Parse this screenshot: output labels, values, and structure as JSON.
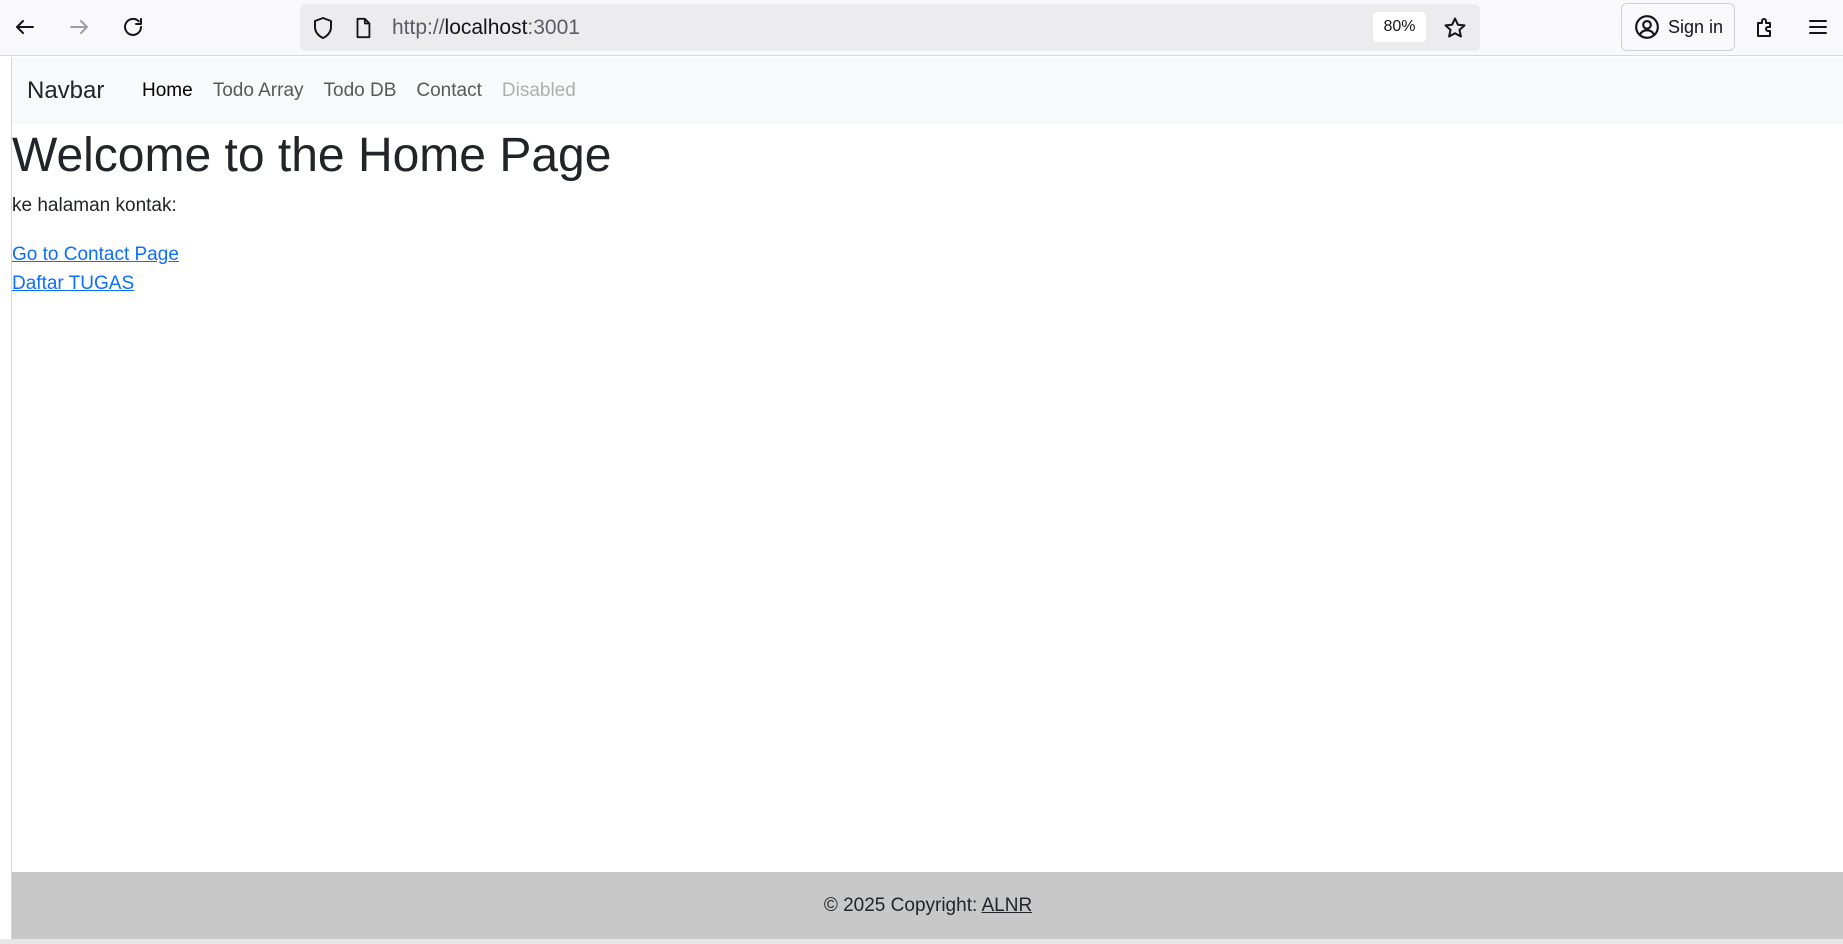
{
  "browser": {
    "url_scheme": "http://",
    "url_host": "localhost",
    "url_port": ":3001",
    "zoom": "80%",
    "sign_in_label": "Sign in",
    "icons": {
      "back": "arrow-left-icon",
      "forward": "arrow-right-icon",
      "reload": "reload-icon",
      "shield": "shield-icon",
      "page": "page-icon",
      "bookmark": "star-icon",
      "account": "account-icon",
      "extensions": "puzzle-icon",
      "menu": "hamburger-menu-icon"
    }
  },
  "navbar": {
    "brand": "Navbar",
    "links": [
      {
        "label": "Home",
        "state": "active"
      },
      {
        "label": "Todo Array",
        "state": "normal"
      },
      {
        "label": "Todo DB",
        "state": "normal"
      },
      {
        "label": "Contact",
        "state": "normal"
      },
      {
        "label": "Disabled",
        "state": "disabled"
      }
    ]
  },
  "main": {
    "title": "Welcome to the Home Page",
    "subtitle": "ke halaman kontak:",
    "links": [
      {
        "label": "Go to Contact Page"
      },
      {
        "label": "Daftar TUGAS"
      }
    ]
  },
  "footer": {
    "text": "© 2025 Copyright: ",
    "link": "ALNR"
  },
  "colors": {
    "link": "#0d6efd",
    "navbar_bg": "#f8f9fa",
    "footer_bg": "#c8c8c8",
    "text": "#212529"
  }
}
